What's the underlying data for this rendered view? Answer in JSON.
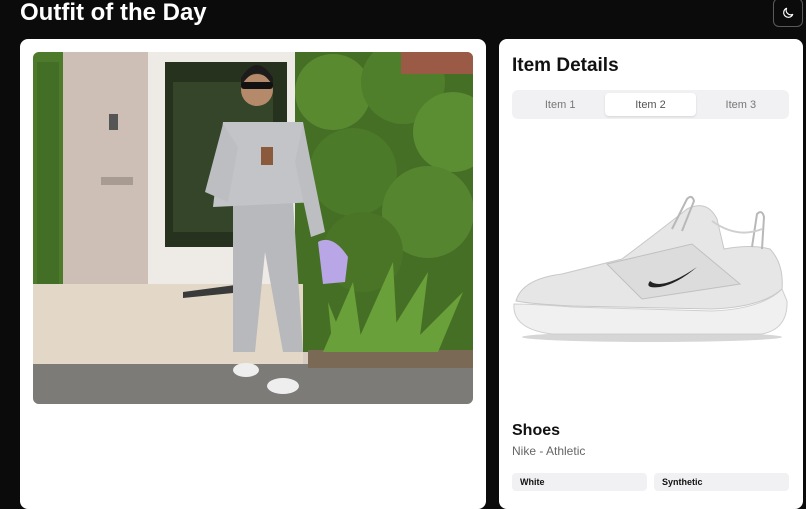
{
  "header": {
    "title": "Outfit of the Day",
    "theme_toggle_icon": "moon-icon"
  },
  "outfit": {
    "photo_icon": "outfit-photo"
  },
  "details": {
    "title": "Item Details",
    "tabs": [
      {
        "label": "Item 1",
        "active": false
      },
      {
        "label": "Item 2",
        "active": true
      },
      {
        "label": "Item 3",
        "active": false
      }
    ],
    "item": {
      "image_icon": "sneaker-image",
      "name": "Shoes",
      "brand": "Nike - Athletic",
      "tags": [
        "White",
        "Synthetic"
      ]
    }
  },
  "colors": {
    "background": "#0b0b0b",
    "card": "#ffffff",
    "tab_bg": "#f1f1f3"
  }
}
